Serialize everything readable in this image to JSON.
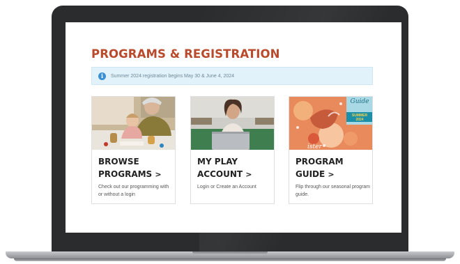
{
  "page": {
    "title": "PROGRAMS & REGISTRATION",
    "notice": {
      "icon": "info-icon",
      "text": "Summer 2024 registration begins May 30 & June 4, 2024"
    }
  },
  "cards": [
    {
      "heading_line1": "BROWSE",
      "heading_line2": "PROGRAMS",
      "chevron": ">",
      "description": "Check out our programming with or without a login"
    },
    {
      "heading_line1": "MY PLAY",
      "heading_line2": "ACCOUNT",
      "chevron": ">",
      "description": "Login or Create an Account"
    },
    {
      "heading_line1": "PROGRAM",
      "heading_line2": "GUIDE",
      "chevron": ">",
      "description": "Flip through our seasonal program guide.",
      "guide_badge": {
        "label": "Guide",
        "season": "SUMMER",
        "year": "2024"
      }
    }
  ],
  "colors": {
    "title": "#b94a2c",
    "notice_bg": "#e1f2fa",
    "info_icon": "#3b8fd4"
  }
}
